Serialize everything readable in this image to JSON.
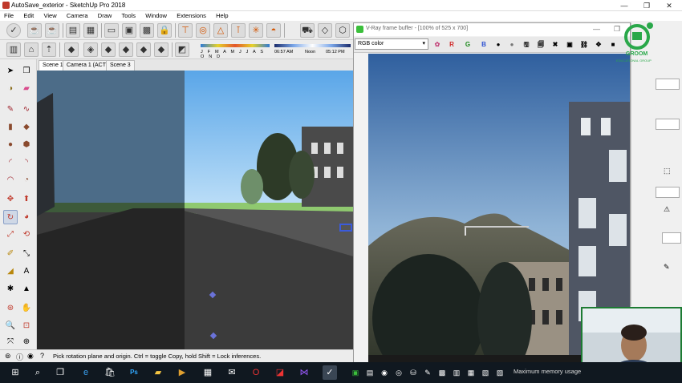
{
  "window": {
    "title": "AutoSave_exterior - SketchUp Pro 2018",
    "controls": [
      "minimize-icon",
      "maximize-icon",
      "close-icon"
    ]
  },
  "menu": [
    "File",
    "Edit",
    "View",
    "Camera",
    "Draw",
    "Tools",
    "Window",
    "Extensions",
    "Help"
  ],
  "shadow_bar": {
    "months": "J F M A M J J A S O N D",
    "time_start": "06:57 AM",
    "time_mid": "Noon",
    "time_end": "05:12 PM"
  },
  "scene_tabs": [
    "Scene 1",
    "Camera 1 (ACT)",
    "Scene 3"
  ],
  "status": {
    "text": "Pick rotation plane and origin.  Ctrl = toggle Copy, hold Shift = Lock inferences."
  },
  "vray": {
    "title": "V-Ray frame buffer - [100% of 525 x 700]",
    "channel": "RGB color",
    "channel_buttons": [
      "R",
      "G",
      "B"
    ],
    "status": "Maximum memory usage"
  },
  "logo": {
    "text": "GROOM",
    "subtitle": "EDUCATIONAL GROUP"
  },
  "colors": {
    "accent_red": "#c0392b",
    "vray_green": "#3bbf3b",
    "sky": "#6fb4ec",
    "grass": "#8fc96f"
  }
}
